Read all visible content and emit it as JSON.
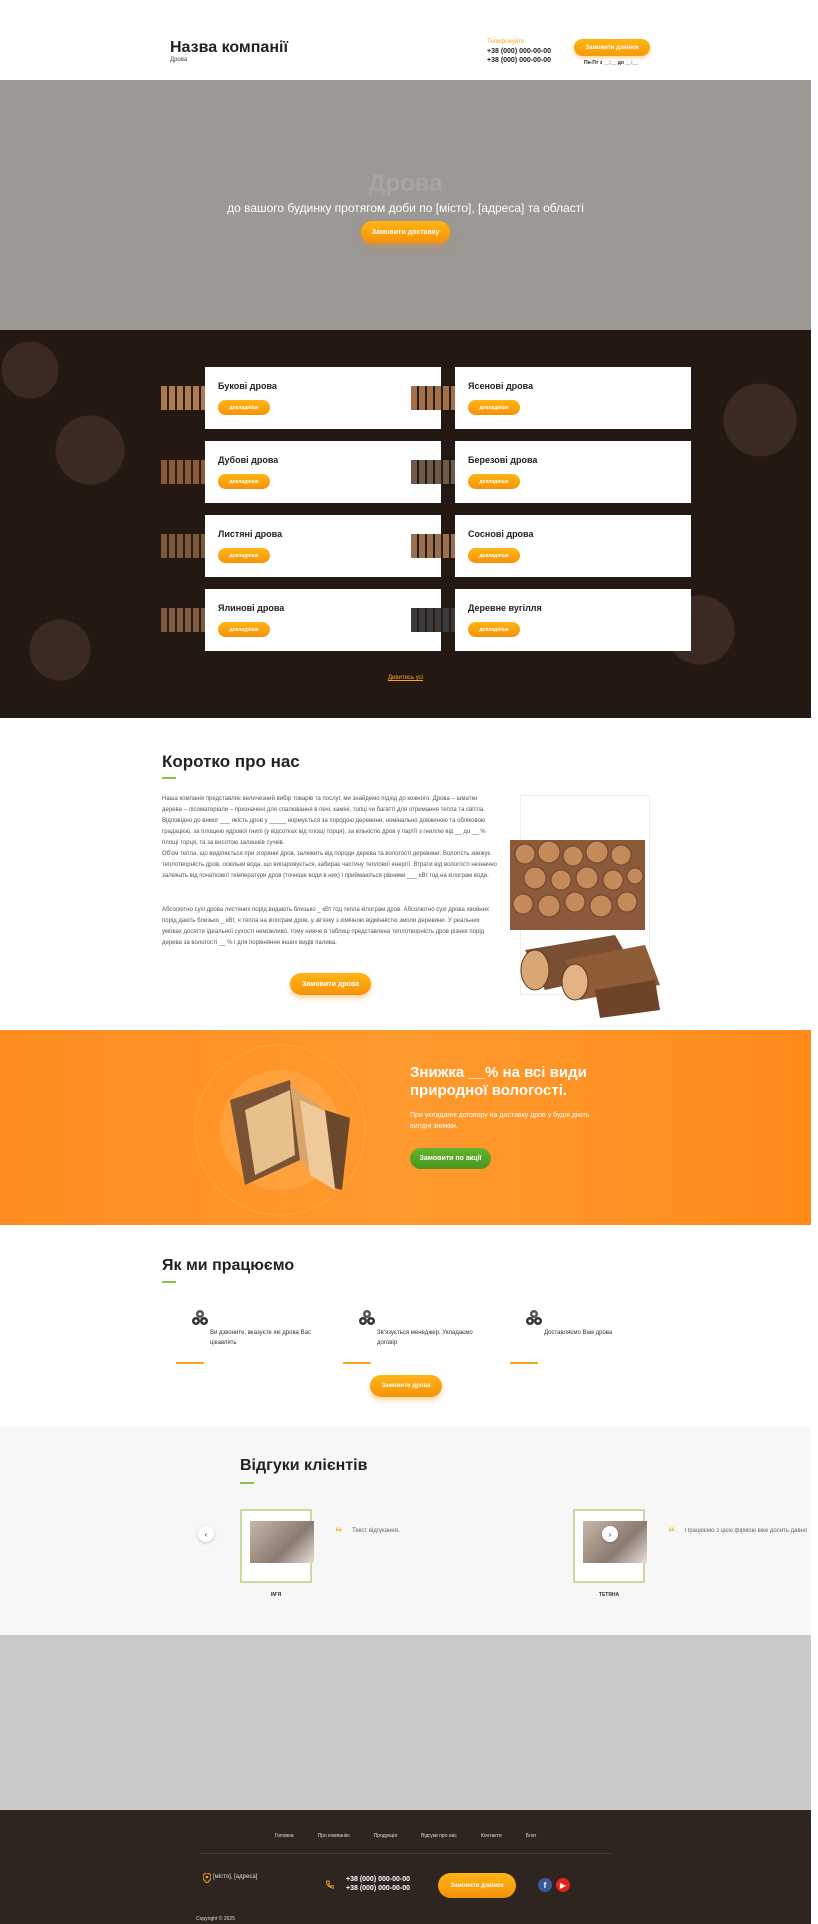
{
  "colors": {
    "accent": "#f7a51c",
    "green": "#5aa827",
    "dark_bg": "#241813",
    "footer_bg": "#2e2420"
  },
  "header": {
    "company_name": "Назва компанії",
    "subtitle": "Дрова",
    "phones_label": "Телефонуйте:",
    "phone_1": "+38 (000) 000-00-00",
    "phone_2": "+38 (000) 000-00-00",
    "callback_button": "Замовити дзвінок",
    "hours": "Пн-Пт з __:__ до __:__"
  },
  "hero": {
    "title": "Дрова",
    "subtitle": "до вашого будинку протягом доби по [місто], [адреса] та області",
    "button": "Замовити доставку"
  },
  "products": {
    "items": [
      {
        "name": "Букові дрова",
        "button": "докладніше",
        "icon": "firewood-stack-icon"
      },
      {
        "name": "Ясенові дрова",
        "button": "докладніше",
        "icon": "firewood-stack-icon"
      },
      {
        "name": "Дубові дрова",
        "button": "докладніше",
        "icon": "firewood-stack-icon"
      },
      {
        "name": "Березові дрова",
        "button": "докладніше",
        "icon": "firewood-stack-icon"
      },
      {
        "name": "Листяні дрова",
        "button": "докладніше",
        "icon": "firewood-stack-icon"
      },
      {
        "name": "Соснові дрова",
        "button": "докладніше",
        "icon": "firewood-stack-icon"
      },
      {
        "name": "Ялинові дрова",
        "button": "докладніше",
        "icon": "firewood-stack-icon"
      },
      {
        "name": "Деревне вугілля",
        "button": "докладніше",
        "icon": "charcoal-icon"
      }
    ],
    "see_all": "Дивитись усі"
  },
  "about": {
    "title": "Коротко про нас",
    "p1": "Наша компанія представляє величезний вибір товарів та послуг, ми знайдемо підхід до кожного. Дрова – шматки дерева – лісоматеріали – призначені для спалювання в печі, каміні, топці чи багатті для отримання тепла та світла. Відповідно до вимог ___ якість дров у _____ нормується за породою деревини, номінально довжиною та обліковою градацією, за площею ядрової гнилі (у відсотках від площі торця), за кількістю дров у партії з гниллю від __ до __ % площі торця, та за висотою залишків сучків.",
    "p2": "Об'єм тепла, що виділяється при згорянні дров, залежить від породи дерева та вологості деревини. Вологість знижує теплотворність дров, оскільки вода, що випаровується, забирає частину теплової енергії. Втрати від вологості незначно залежать від початкової температури дров (точніше води в них) і приймаються рівними ___ кВт год на кілограм води.",
    "p3": "Абсолютно сухі дрова листяних порід видають близько _ кВт год тепла кілограм дров. Абсолютно сухі дрова хвойних порід дають близько _ кВт, ч тепла на кілограм дров, у зв'язку з хімічною відмінністю змоли деревини. У реальних умовах досягти ідеальної сухості неможливо, тому нижче в таблиці представлена теплотворність дров різних порід дерева за вологості __ % і для порівняння інших видів палива.",
    "button": "Замовити дрова"
  },
  "discount": {
    "title": "Знижка __% на всі види природної вологості.",
    "text": "При укладанні договору на доставку дров у будні діють вигідні знижки.",
    "button": "Замовити по акції"
  },
  "how": {
    "title": "Як ми працюємо",
    "steps": [
      {
        "text": "Ви дзвоните, вказуєте які дрова Вас цікавлять",
        "icon": "firewood-icon"
      },
      {
        "text": "Зв'язується менеджер. Укладаємо договір",
        "icon": "firewood-icon"
      },
      {
        "text": "Доставляємо Вам дрова",
        "icon": "firewood-icon"
      }
    ],
    "button": "Замовити дрова"
  },
  "reviews": {
    "title": "Відгуки клієнтів",
    "items": [
      {
        "name": "ІМ'Я",
        "text": "Текст відгукання."
      },
      {
        "name": "ТЕТЯНА",
        "text": "Працюємо з цією фірмою вже досить давно"
      }
    ]
  },
  "footer": {
    "nav": [
      "Головна",
      "Про компанію",
      "Продукція",
      "Відгуки про нас",
      "Контакти",
      "Блог"
    ],
    "address": "[місто], [адреса]",
    "phone_1": "+38 (000) 000-00-00",
    "phone_2": "+38 (000) 000-00-00",
    "callback_button": "Замовити дзвінок",
    "copyright": "Copyright © 2025",
    "social": [
      {
        "name": "facebook-icon",
        "glyph": "f",
        "color": "#3b5998"
      },
      {
        "name": "youtube-icon",
        "glyph": "▶",
        "color": "#e62117"
      }
    ]
  }
}
